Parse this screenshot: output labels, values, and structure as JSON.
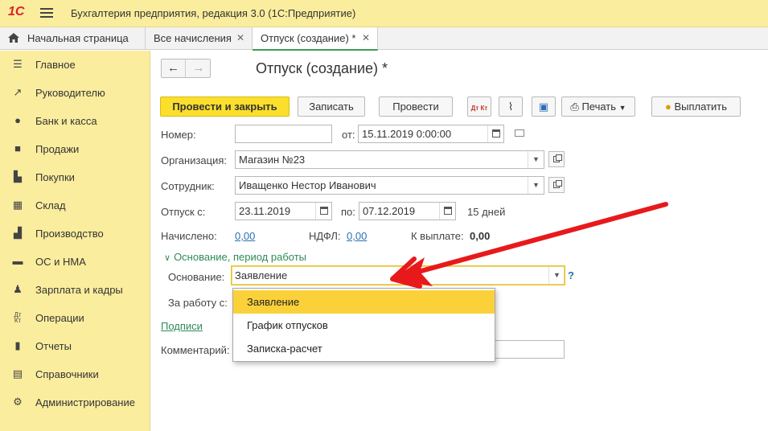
{
  "app": {
    "logo": "1С",
    "title": "Бухгалтерия предприятия, редакция 3.0   (1С:Предприятие)"
  },
  "tabs": [
    {
      "label": "Начальная страница",
      "closable": false,
      "active": false
    },
    {
      "label": "Все начисления",
      "closable": true,
      "active": false
    },
    {
      "label": "Отпуск (создание) *",
      "closable": true,
      "active": true
    }
  ],
  "sidebar": {
    "items": [
      {
        "label": "Главное",
        "icon": "list-icon"
      },
      {
        "label": "Руководителю",
        "icon": "trend-icon"
      },
      {
        "label": "Банк и касса",
        "icon": "coin-icon"
      },
      {
        "label": "Продажи",
        "icon": "bag-icon"
      },
      {
        "label": "Покупки",
        "icon": "cart-icon"
      },
      {
        "label": "Склад",
        "icon": "grid-icon"
      },
      {
        "label": "Производство",
        "icon": "factory-icon"
      },
      {
        "label": "ОС и НМА",
        "icon": "truck-icon"
      },
      {
        "label": "Зарплата и кадры",
        "icon": "person-icon"
      },
      {
        "label": "Операции",
        "icon": "dtkt-icon"
      },
      {
        "label": "Отчеты",
        "icon": "bar-chart-icon"
      },
      {
        "label": "Справочники",
        "icon": "books-icon"
      },
      {
        "label": "Администрирование",
        "icon": "gear-icon"
      }
    ]
  },
  "document": {
    "title": "Отпуск (создание) *",
    "toolbar": {
      "post_close": "Провести и закрыть",
      "save": "Записать",
      "post": "Провести",
      "dtkt": "Дт Кт",
      "print": "Печать",
      "pay": "Выплатить"
    },
    "fields": {
      "number_label": "Номер:",
      "number_value": "",
      "date_label": "от:",
      "date_value": "15.11.2019  0:00:00",
      "org_label": "Организация:",
      "org_value": "Магазин №23",
      "employee_label": "Сотрудник:",
      "employee_value": "Иващенко Нестор Иванович",
      "vacation_from_label": "Отпуск с:",
      "vacation_from_value": "23.11.2019",
      "vacation_to_label": "по:",
      "vacation_to_value": "07.12.2019",
      "days_text": "15 дней",
      "accrued_label": "Начислено:",
      "accrued_value": "0,00",
      "ndfl_label": "НДФЛ:",
      "ndfl_value": "0,00",
      "payout_label": "К выплате:",
      "payout_value": "0,00",
      "section_label": "Основание, период работы",
      "basis_label": "Основание:",
      "basis_value": "Заявление",
      "help": "?",
      "work_period_label": "За работу с:",
      "signatures_link": "Подписи",
      "comment_label": "Комментарий:",
      "comment_value": ""
    },
    "dropdown_options": [
      "Заявление",
      "График отпусков",
      "Записка-расчет"
    ],
    "dropdown_selected": 0
  },
  "colors": {
    "sidebar_bg": "#fbed9e",
    "primary_button": "#fbdf2c",
    "selected_option": "#fbd13a",
    "section_green": "#2e8b57",
    "link_blue": "#2c6eb5",
    "arrow_red": "#e8191b"
  }
}
